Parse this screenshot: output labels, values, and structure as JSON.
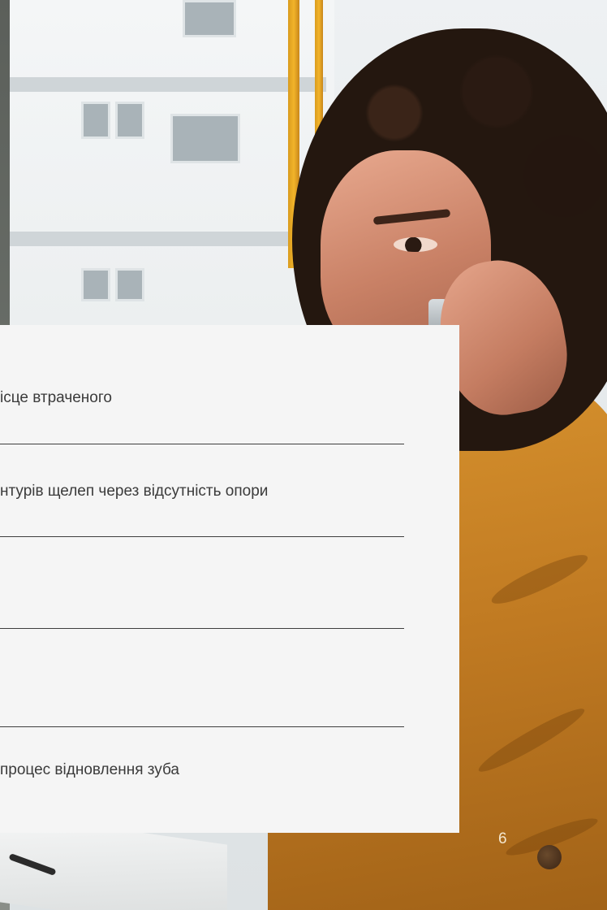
{
  "list": {
    "items": [
      {
        "text": "ісце втраченого"
      },
      {
        "text": "нтурів щелеп через відсутність опори"
      },
      {
        "text": ""
      },
      {
        "text": ""
      },
      {
        "text": "процес відновлення зуба"
      }
    ]
  },
  "page": {
    "number": "6"
  },
  "colors": {
    "card_background": "#f5f5f5",
    "text": "#3b3b3b",
    "rule": "#3e3e3e",
    "page_number": "#f4e7cf"
  }
}
